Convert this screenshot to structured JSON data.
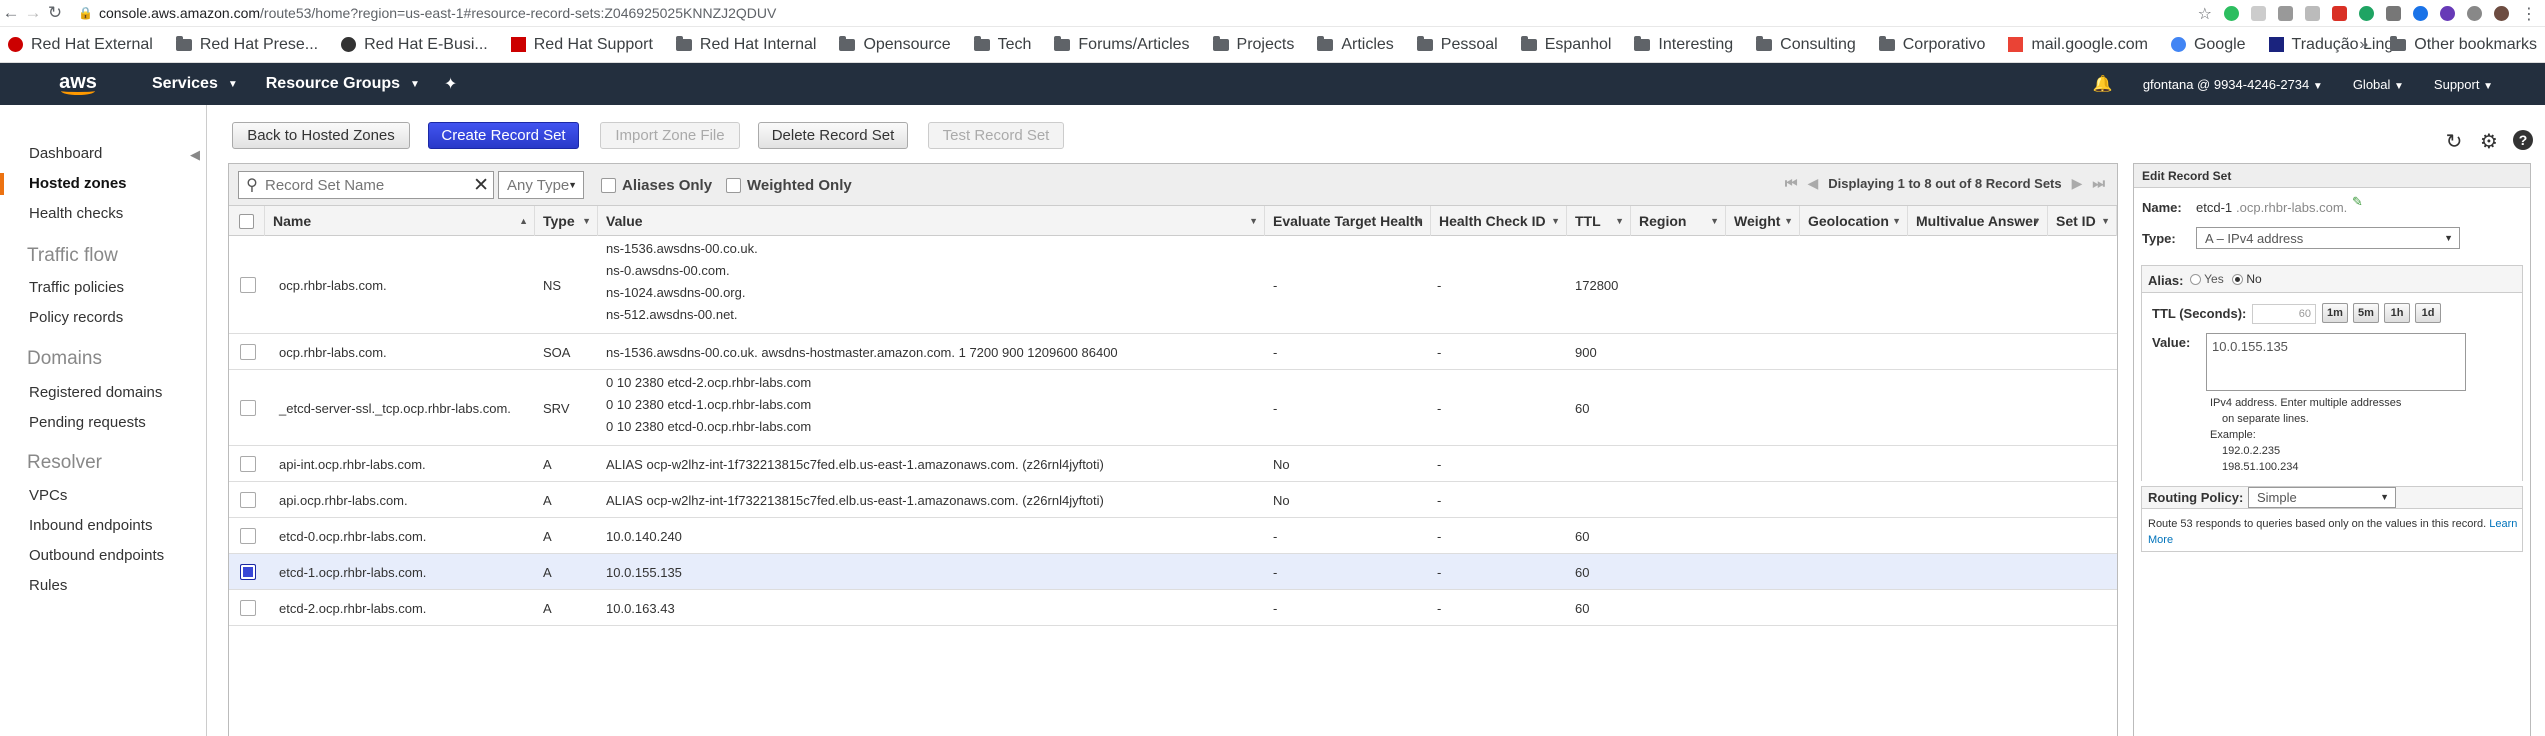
{
  "browser": {
    "url_host": "console.aws.amazon.com",
    "url_path": "/route53/home?region=us-east-1#resource-record-sets:Z046925025KNNZJ2QDUV",
    "bookmarks": [
      {
        "label": "Red Hat External",
        "icon": "red-hat-icon"
      },
      {
        "label": "Red Hat Prese...",
        "icon": "folder-icon"
      },
      {
        "label": "Red Hat E-Busi...",
        "icon": "globe-icon"
      },
      {
        "label": "Red Hat Support",
        "icon": "red-hat-box-icon"
      },
      {
        "label": "Red Hat Internal",
        "icon": "folder-icon"
      },
      {
        "label": "Opensource",
        "icon": "folder-icon"
      },
      {
        "label": "Tech",
        "icon": "folder-icon"
      },
      {
        "label": "Forums/Articles",
        "icon": "folder-icon"
      },
      {
        "label": "Projects",
        "icon": "folder-icon"
      },
      {
        "label": "Articles",
        "icon": "folder-icon"
      },
      {
        "label": "Pessoal",
        "icon": "folder-icon"
      },
      {
        "label": "Espanhol",
        "icon": "folder-icon"
      },
      {
        "label": "Interesting",
        "icon": "folder-icon"
      },
      {
        "label": "Consulting",
        "icon": "folder-icon"
      },
      {
        "label": "Corporativo",
        "icon": "folder-icon"
      },
      {
        "label": "mail.google.com",
        "icon": "gmail-icon"
      },
      {
        "label": "Google",
        "icon": "google-icon"
      },
      {
        "label": "Tradução Ling...",
        "icon": "translate-icon"
      }
    ],
    "other_bookmarks": "Other bookmarks",
    "more": "»"
  },
  "aws_nav": {
    "logo": "aws",
    "services": "Services",
    "resource_groups": "Resource Groups",
    "account": "gfontana @ 9934-4246-2734",
    "region": "Global",
    "support": "Support"
  },
  "sidebar": {
    "items": {
      "dashboard": "Dashboard",
      "hosted_zones": "Hosted zones",
      "health_checks": "Health checks",
      "traffic_flow": "Traffic flow",
      "traffic_policies": "Traffic policies",
      "policy_records": "Policy records",
      "domains": "Domains",
      "registered_domains": "Registered domains",
      "pending_requests": "Pending requests",
      "resolver": "Resolver",
      "vpcs": "VPCs",
      "inbound_endpoints": "Inbound endpoints",
      "outbound_endpoints": "Outbound endpoints",
      "rules": "Rules"
    }
  },
  "toolbar": {
    "back": "Back to Hosted Zones",
    "create": "Create Record Set",
    "import": "Import Zone File",
    "delete": "Delete Record Set",
    "test": "Test Record Set"
  },
  "filter": {
    "search_placeholder": "Record Set Name",
    "type": "Any Type",
    "aliases_only": "Aliases Only",
    "weighted_only": "Weighted Only",
    "paging": "Displaying 1 to 8 out of 8 Record Sets"
  },
  "table": {
    "columns": [
      "Name",
      "Type",
      "Value",
      "Evaluate Target Health",
      "Health Check ID",
      "TTL",
      "Region",
      "Weight",
      "Geolocation",
      "Multivalue Answer",
      "Set ID"
    ],
    "rows": [
      {
        "name": "ocp.rhbr-labs.com.",
        "type": "NS",
        "value": [
          "ns-1536.awsdns-00.co.uk.",
          "ns-0.awsdns-00.com.",
          "ns-1024.awsdns-00.org.",
          "ns-512.awsdns-00.net."
        ],
        "eth": "-",
        "hc": "-",
        "ttl": "172800",
        "selected": false
      },
      {
        "name": "ocp.rhbr-labs.com.",
        "type": "SOA",
        "value": [
          "ns-1536.awsdns-00.co.uk. awsdns-hostmaster.amazon.com. 1 7200 900 1209600 86400"
        ],
        "eth": "-",
        "hc": "-",
        "ttl": "900",
        "selected": false
      },
      {
        "name": "_etcd-server-ssl._tcp.ocp.rhbr-labs.com.",
        "type": "SRV",
        "value": [
          "0 10 2380 etcd-2.ocp.rhbr-labs.com",
          "0 10 2380 etcd-1.ocp.rhbr-labs.com",
          "0 10 2380 etcd-0.ocp.rhbr-labs.com"
        ],
        "eth": "-",
        "hc": "-",
        "ttl": "60",
        "selected": false
      },
      {
        "name": "api-int.ocp.rhbr-labs.com.",
        "type": "A",
        "value": [
          "ALIAS ocp-w2lhz-int-1f732213815c7fed.elb.us-east-1.amazonaws.com. (z26rnl4jyftoti)"
        ],
        "eth": "No",
        "hc": "-",
        "ttl": "",
        "selected": false
      },
      {
        "name": "api.ocp.rhbr-labs.com.",
        "type": "A",
        "value": [
          "ALIAS ocp-w2lhz-int-1f732213815c7fed.elb.us-east-1.amazonaws.com. (z26rnl4jyftoti)"
        ],
        "eth": "No",
        "hc": "-",
        "ttl": "",
        "selected": false
      },
      {
        "name": "etcd-0.ocp.rhbr-labs.com.",
        "type": "A",
        "value": [
          "10.0.140.240"
        ],
        "eth": "-",
        "hc": "-",
        "ttl": "60",
        "selected": false
      },
      {
        "name": "etcd-1.ocp.rhbr-labs.com.",
        "type": "A",
        "value": [
          "10.0.155.135"
        ],
        "eth": "-",
        "hc": "-",
        "ttl": "60",
        "selected": true
      },
      {
        "name": "etcd-2.ocp.rhbr-labs.com.",
        "type": "A",
        "value": [
          "10.0.163.43"
        ],
        "eth": "-",
        "hc": "-",
        "ttl": "60",
        "selected": false
      }
    ]
  },
  "edit_panel": {
    "title": "Edit Record Set",
    "name_label": "Name:",
    "name_prefix": "etcd-1",
    "name_suffix": ".ocp.rhbr-labs.com.",
    "type_label": "Type:",
    "type_value": "A – IPv4 address",
    "alias_label": "Alias:",
    "alias_yes": "Yes",
    "alias_no": "No",
    "ttl_label": "TTL (Seconds):",
    "ttl_value": "60",
    "ttl_buttons": [
      "1m",
      "5m",
      "1h",
      "1d"
    ],
    "value_label": "Value:",
    "value": "10.0.155.135",
    "help_1": "IPv4 address. Enter multiple addresses",
    "help_2": "on separate lines.",
    "example_label": "Example:",
    "example_1": "192.0.2.235",
    "example_2": "198.51.100.234",
    "routing_label": "Routing Policy:",
    "routing_value": "Simple",
    "routing_help": "Route 53 responds to queries based only on the values in this record.",
    "learn_1": "Learn",
    "learn_2": "More"
  },
  "colors": {
    "aws_nav_bg": "#232f3e",
    "aws_orange": "#ff9900",
    "primary_button": "#2939c9",
    "selected_row": "#e7edfb"
  }
}
